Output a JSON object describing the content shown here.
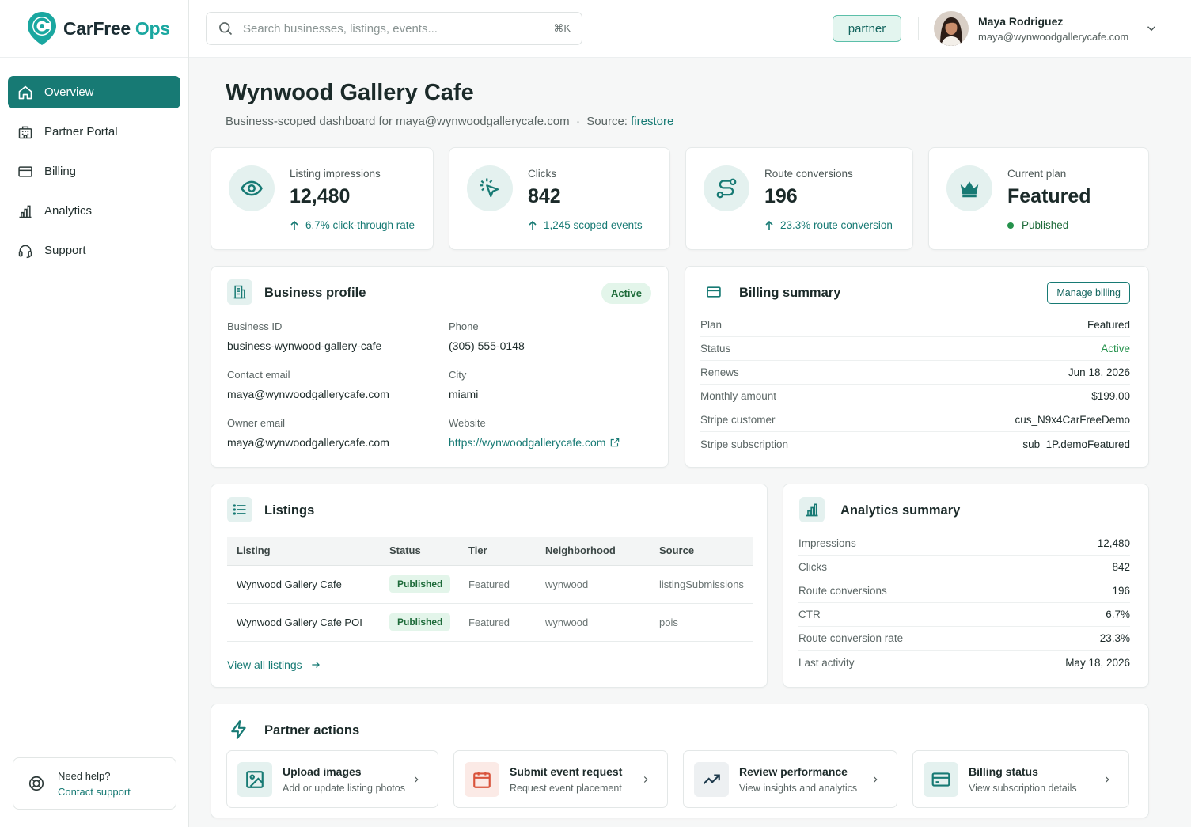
{
  "brand": {
    "name_part1": "CarFree",
    "name_part2": " Ops"
  },
  "sidebar": {
    "items": [
      {
        "label": "Overview"
      },
      {
        "label": "Partner Portal"
      },
      {
        "label": "Billing"
      },
      {
        "label": "Analytics"
      },
      {
        "label": "Support"
      }
    ],
    "help": {
      "title": "Need help?",
      "link": "Contact support"
    }
  },
  "topbar": {
    "search_placeholder": "Search businesses, listings, events...",
    "search_shortcut": "⌘K",
    "role": "partner",
    "user": {
      "name": "Maya Rodriguez",
      "email": "maya@wynwoodgallerycafe.com"
    }
  },
  "page": {
    "title": "Wynwood Gallery Cafe",
    "subtitle_prefix": "Business-scoped dashboard for maya@wynwoodgallerycafe.com  ·  Source: ",
    "source": "firestore"
  },
  "stats": [
    {
      "label": "Listing impressions",
      "value": "12,480",
      "sub": "6.7% click-through rate"
    },
    {
      "label": "Clicks",
      "value": "842",
      "sub": "1,245 scoped events"
    },
    {
      "label": "Route conversions",
      "value": "196",
      "sub": "23.3% route conversion"
    },
    {
      "label": "Current plan",
      "value": "Featured",
      "sub": "Published"
    }
  ],
  "business_profile": {
    "title": "Business profile",
    "status": "Active",
    "fields": {
      "business_id_label": "Business ID",
      "business_id": "business-wynwood-gallery-cafe",
      "phone_label": "Phone",
      "phone": "(305) 555-0148",
      "contact_email_label": "Contact email",
      "contact_email": "maya@wynwoodgallerycafe.com",
      "city_label": "City",
      "city": "miami",
      "owner_email_label": "Owner email",
      "owner_email": "maya@wynwoodgallerycafe.com",
      "website_label": "Website",
      "website": "https://wynwoodgallerycafe.com"
    }
  },
  "billing_summary": {
    "title": "Billing summary",
    "manage_label": "Manage billing",
    "rows": [
      {
        "k": "Plan",
        "v": "Featured"
      },
      {
        "k": "Status",
        "v": "Active"
      },
      {
        "k": "Renews",
        "v": "Jun 18, 2026"
      },
      {
        "k": "Monthly amount",
        "v": "$199.00"
      },
      {
        "k": "Stripe customer",
        "v": "cus_N9x4CarFreeDemo"
      },
      {
        "k": "Stripe subscription",
        "v": "sub_1P.demoFeatured"
      }
    ],
    "status_color": "#25924c"
  },
  "listings": {
    "title": "Listings",
    "columns": [
      "Listing",
      "Status",
      "Tier",
      "Neighborhood",
      "Source"
    ],
    "rows": [
      {
        "listing": "Wynwood Gallery Cafe",
        "status": "Published",
        "tier": "Featured",
        "neighborhood": "wynwood",
        "source": "listingSubmissions"
      },
      {
        "listing": "Wynwood Gallery Cafe POI",
        "status": "Published",
        "tier": "Featured",
        "neighborhood": "wynwood",
        "source": "pois"
      }
    ],
    "view_all": "View all listings"
  },
  "analytics_summary": {
    "title": "Analytics summary",
    "rows": [
      {
        "k": "Impressions",
        "v": "12,480"
      },
      {
        "k": "Clicks",
        "v": "842"
      },
      {
        "k": "Route conversions",
        "v": "196"
      },
      {
        "k": "CTR",
        "v": "6.7%"
      },
      {
        "k": "Route conversion rate",
        "v": "23.3%"
      },
      {
        "k": "Last activity",
        "v": "May 18, 2026"
      }
    ]
  },
  "partner_actions": {
    "title": "Partner actions",
    "items": [
      {
        "title": "Upload images",
        "desc": "Add or update listing photos",
        "icon": "image-icon"
      },
      {
        "title": "Submit event request",
        "desc": "Request event placement",
        "icon": "calendar-icon"
      },
      {
        "title": "Review performance",
        "desc": "View insights and analytics",
        "icon": "trending-up-icon"
      },
      {
        "title": "Billing status",
        "desc": "View subscription details",
        "icon": "credit-card-icon"
      }
    ]
  },
  "colors": {
    "accent": "#177a74",
    "brand_teal": "#1aa7a0",
    "success": "#25924c",
    "event_accent": "#d9533b"
  }
}
